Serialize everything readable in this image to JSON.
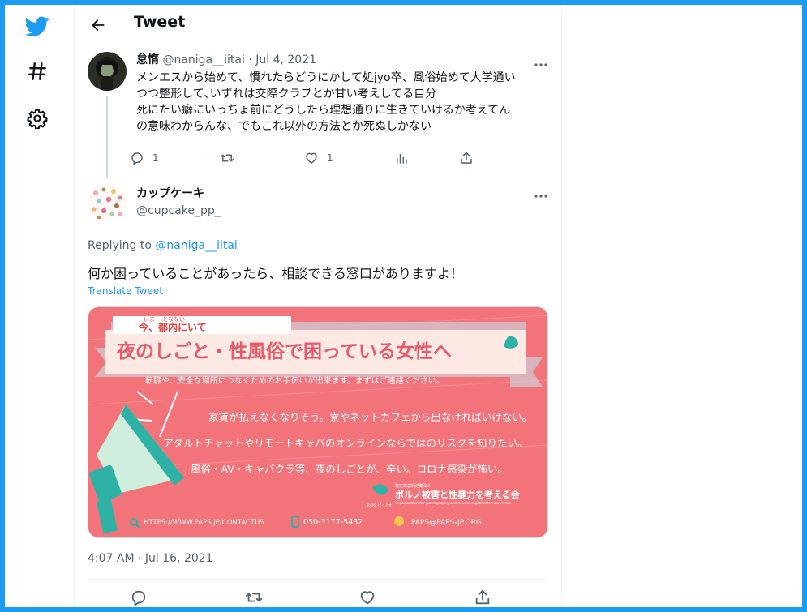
{
  "app": {
    "accent": "#1d9bf0"
  },
  "nav": {
    "icons": [
      "twitter-bird-icon",
      "hashtag-icon",
      "gear-icon"
    ]
  },
  "header": {
    "title": "Tweet"
  },
  "tweet1": {
    "name": "怠惰",
    "handle": "@naniga__iitai",
    "separator": "·",
    "date": "Jul 4, 2021",
    "lines": [
      "メンエスから始めて、慣れたらどうにかして処jyo卒、風俗始めて大学通い",
      "つつ整形して､いずれは交際クラブとか甘い考えしてる自分",
      "死にたい癖にいっちょ前にどうしたら理想通りに生きていけるか考えてん",
      "の意味わからんな、でもこれ以外の方法とか死ぬしかない"
    ],
    "reply_count": "1",
    "like_count": "1"
  },
  "tweet2": {
    "name": "カップケーキ",
    "handle": "@cupcake_pp_",
    "replying_label": "Replying to",
    "replying_to": "@naniga__iitai",
    "text": "何か困っていることがあったら、相談できる窓口がありますよ！",
    "translate": "Translate Tweet",
    "timestamp": "4:07 AM · Jul 16, 2021"
  },
  "poster": {
    "ruby_top": "いま　 となない",
    "subtitle": "今、都内にいて",
    "headline": "夜のしごと・性風俗で困っている女性へ",
    "lead": "転職や、安全な場所につなぐためのお手伝いが出来ます。まずはご連絡ください。",
    "items": [
      "家賃が払えなくなりそう。寮やネットカフェから出なければいけない。",
      "アダルトチャットやリモートキャバのオンラインならではのリスクを知りたい。",
      "風俗・AV・キャバクラ等、夜のしごとが、辛い。コロナ感染が怖い。"
    ],
    "org_small": "特定非営利活動法人",
    "org_name": "ポルノ被害と性暴力を考える会",
    "org_en1": "Organization for pornography and sexual exploitation survivors",
    "org_short": "PAPS ぱっぷす",
    "url": "HTTPS://WWW.PAPS.JP/CONTACTUS",
    "phone": "050-3177-5432",
    "email": "PAPS@PAPS-JP.ORG",
    "colors": {
      "bg": "#f2747a",
      "banner": "#fde9e4",
      "headline": "#e85a6a",
      "teal": "#2fb2a6",
      "megaphone": "#cfeedd"
    }
  }
}
